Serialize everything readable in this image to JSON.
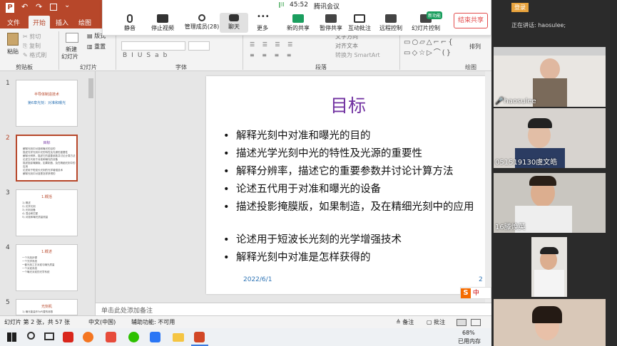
{
  "app": {
    "login": "登录",
    "title_glyph": "P"
  },
  "tabs": [
    {
      "label": "文件"
    },
    {
      "label": "开始"
    },
    {
      "label": "插入"
    },
    {
      "label": "绘图"
    }
  ],
  "clipboard": {
    "paste": "粘贴",
    "cut": "剪切",
    "copy": "复制",
    "format_painter": "格式刷",
    "group": "剪贴板"
  },
  "slides_group": {
    "new_slide_1": "新建",
    "new_slide_2": "幻灯片",
    "layout": "版式",
    "reset": "重置",
    "group": "幻灯片"
  },
  "font_group": {
    "label": "字体"
  },
  "paragraph_group": {
    "label": "段落",
    "text_direction": "文字方向",
    "align_text": "对齐文本",
    "smartart": "转换为 SmartArt"
  },
  "drawing_group": {
    "label": "绘图",
    "arrange": "排列"
  },
  "meeting": {
    "signal": "∥ll",
    "time": "45:52",
    "name": "腾讯会议",
    "mute": "静音",
    "stop_video": "停止视频",
    "manage_members": "管理成员(28)",
    "chat": "聊天",
    "more": "更多",
    "new_share": "新的共享",
    "pause_share": "暂停共享",
    "interactive_annotate": "互动批注",
    "remote_control": "远程控制",
    "slide_control": "幻灯片控制",
    "new_badge": "新功能",
    "end_share": "结束共享"
  },
  "thumbnails": [
    {
      "num": "1",
      "title": "半导体制造技术",
      "subtitle": "第6章光刻：对准和曝光",
      "lines": []
    },
    {
      "num": "2",
      "title": "目标",
      "subtitle": "",
      "lines": [
        "解释光刻中对准和曝光的目的",
        "描述光学光刻中光的特性及光源的重要性",
        "解释分辨率，描述它的重要参数并讨论计算方法",
        "论述五代用于对准和曝光的设备",
        "描述投影掩膜版，如果制造，及在精细光刻中的应用",
        "论述用于短波长光刻的光学增强技术",
        "解释光刻中对准是怎样获得的"
      ]
    },
    {
      "num": "3",
      "title": "1.概括",
      "subtitle": "",
      "lines": [
        "1) 概述",
        "2) 光学光刻",
        "3) 光刻设备",
        "4) 混合和匹配",
        "5) 对准和曝光质量测量"
      ]
    },
    {
      "num": "4",
      "title": "1.概述",
      "subtitle": "",
      "lines": [
        "一个光刻步骤",
        "一个光学系统",
        "一套光刻工艺对准与曝光质量",
        "一个对准系统",
        "一个曝光对准的光学系统"
      ]
    },
    {
      "num": "5",
      "title": "光刻机",
      "subtitle": "",
      "lines": [
        "1) 曝光能量作为代替的参数"
      ]
    }
  ],
  "slide": {
    "title": "目标",
    "bullets": [
      "解释光刻中对准和曝光的目的",
      "描述光学光刻中光的特性及光源的重要性",
      "解释分辨率，描述它的重要参数并讨论计算方法",
      "论述五代用于对准和曝光的设备",
      "描述投影掩膜版，如果制造，及在精细光刻中的应用",
      "论述用于短波长光刻的光学增强技术",
      "解释光刻中对准是怎样获得的"
    ],
    "date": "2022/6/1",
    "page": "2",
    "bullet_glyph": "•"
  },
  "notes": {
    "placeholder": "单击此处添加备注"
  },
  "status": {
    "slide_info": "幻灯片 第 2 张，共 57 张",
    "language": "中文(中国)",
    "accessibility": "辅助功能: 不可用",
    "notes": "备注",
    "comments": "批注"
  },
  "taskbar": {
    "memory_pct": "68%",
    "memory_label": "已用内存"
  },
  "ime": {
    "label": "中"
  },
  "video": {
    "speaking": "正在讲话: haosulee;",
    "participants": [
      {
        "name": "haosulee"
      },
      {
        "name": "051519130虞文皓"
      },
      {
        "name": "16滕焕英"
      },
      {
        "name": ""
      },
      {
        "name": ""
      }
    ]
  },
  "colors": {
    "accent": "#b7472a",
    "title": "#7030a0",
    "link": "#2e74b5"
  }
}
